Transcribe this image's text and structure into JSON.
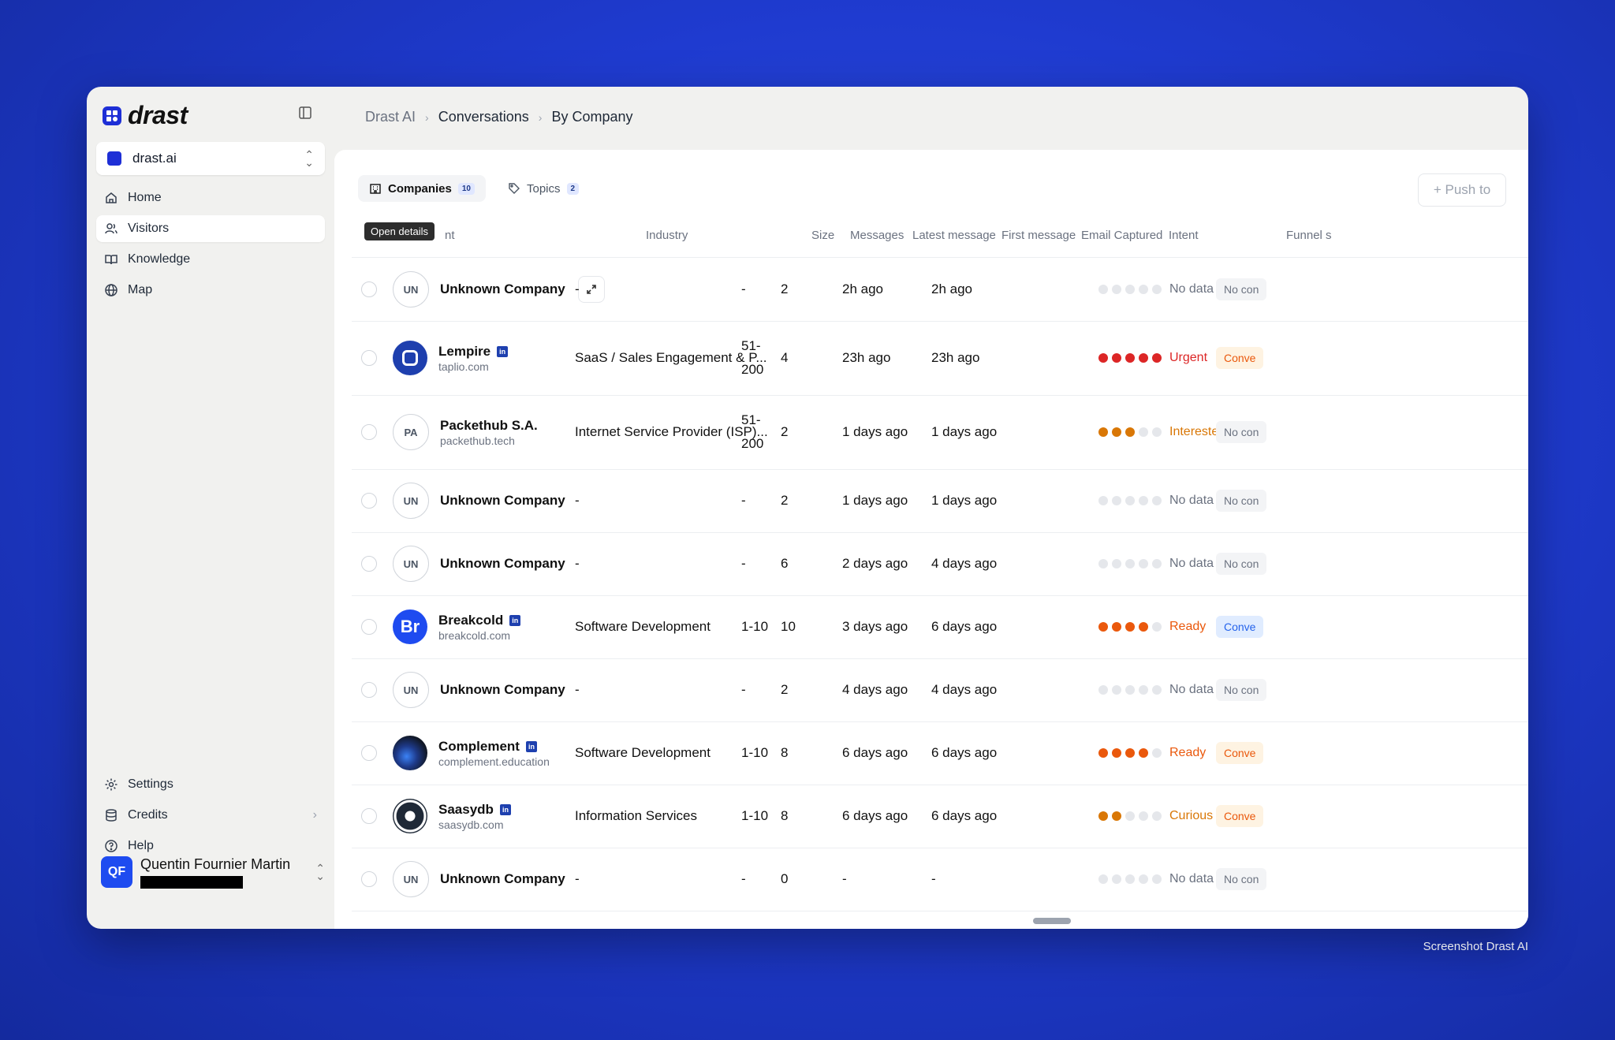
{
  "app": {
    "logo_text": "drast"
  },
  "workspace": {
    "name": "drast.ai"
  },
  "nav": {
    "home": "Home",
    "visitors": "Visitors",
    "knowledge": "Knowledge",
    "map": "Map",
    "settings": "Settings",
    "credits": "Credits",
    "help": "Help"
  },
  "user": {
    "initials": "QF",
    "name": "Quentin Fournier Martin"
  },
  "breadcrumb": {
    "root": "Drast AI",
    "section": "Conversations",
    "current": "By Company"
  },
  "tabs": {
    "companies": {
      "label": "Companies",
      "count": "10"
    },
    "topics": {
      "label": "Topics",
      "count": "2"
    }
  },
  "push_button": "+ Push to",
  "tooltip": "Open details",
  "columns": {
    "account": "nt",
    "industry": "Industry",
    "size": "Size",
    "messages": "Messages",
    "latest": "Latest message",
    "first": "First message",
    "email": "Email Captured",
    "intent": "Intent",
    "funnel": "Funnel s"
  },
  "colors": {
    "urgent": "#dc2626",
    "interested": "#d97706",
    "ready": "#ea580c",
    "curious": "#d97706",
    "dot_empty": "#e5e7eb",
    "accent": "#1e2fd6"
  },
  "rows": [
    {
      "avatar": "UN",
      "name": "Unknown Company",
      "domain": "",
      "linkedin": false,
      "industry": "-",
      "size": "-",
      "size2": "",
      "messages": "2",
      "latest": "2h ago",
      "first": "2h ago",
      "intent": "No data",
      "intent_level": 0,
      "funnel": "No con"
    },
    {
      "avatar": "",
      "name": "Lempire",
      "domain": "taplio.com",
      "linkedin": true,
      "linkedin_label": "in",
      "industry": "SaaS / Sales Engagement & P...",
      "size": "51-",
      "size2": "200",
      "messages": "4",
      "latest": "23h ago",
      "first": "23h ago",
      "intent": "Urgent",
      "intent_level": 5,
      "funnel": "Conve"
    },
    {
      "avatar": "PA",
      "name": "Packethub S.A.",
      "domain": "packethub.tech",
      "linkedin": false,
      "industry": "Internet Service Provider (ISP)...",
      "size": "51-",
      "size2": "200",
      "messages": "2",
      "latest": "1 days ago",
      "first": "1 days ago",
      "intent": "Interested",
      "intent_level": 3,
      "funnel": "No con"
    },
    {
      "avatar": "UN",
      "name": "Unknown Company",
      "domain": "",
      "linkedin": false,
      "industry": "-",
      "size": "-",
      "size2": "",
      "messages": "2",
      "latest": "1 days ago",
      "first": "1 days ago",
      "intent": "No data",
      "intent_level": 0,
      "funnel": "No con"
    },
    {
      "avatar": "UN",
      "name": "Unknown Company",
      "domain": "",
      "linkedin": false,
      "industry": "-",
      "size": "-",
      "size2": "",
      "messages": "6",
      "latest": "2 days ago",
      "first": "4 days ago",
      "intent": "No data",
      "intent_level": 0,
      "funnel": "No con"
    },
    {
      "avatar": "Br",
      "name": "Breakcold",
      "domain": "breakcold.com",
      "linkedin": true,
      "linkedin_label": "in",
      "industry": "Software Development",
      "size": "1-10",
      "size2": "",
      "messages": "10",
      "latest": "3 days ago",
      "first": "6 days ago",
      "intent": "Ready",
      "intent_level": 4,
      "funnel": "Conve"
    },
    {
      "avatar": "UN",
      "name": "Unknown Company",
      "domain": "",
      "linkedin": false,
      "industry": "-",
      "size": "-",
      "size2": "",
      "messages": "2",
      "latest": "4 days ago",
      "first": "4 days ago",
      "intent": "No data",
      "intent_level": 0,
      "funnel": "No con"
    },
    {
      "avatar": "",
      "name": "Complement",
      "domain": "complement.education",
      "linkedin": true,
      "linkedin_label": "in",
      "industry": "Software Development",
      "size": "1-10",
      "size2": "",
      "messages": "8",
      "latest": "6 days ago",
      "first": "6 days ago",
      "intent": "Ready",
      "intent_level": 4,
      "funnel": "Conve"
    },
    {
      "avatar": "",
      "name": "Saasydb",
      "domain": "saasydb.com",
      "linkedin": true,
      "linkedin_label": "in",
      "industry": "Information Services",
      "size": "1-10",
      "size2": "",
      "messages": "8",
      "latest": "6 days ago",
      "first": "6 days ago",
      "intent": "Curious",
      "intent_level": 2,
      "funnel": "Conve"
    },
    {
      "avatar": "UN",
      "name": "Unknown Company",
      "domain": "",
      "linkedin": false,
      "industry": "-",
      "size": "-",
      "size2": "",
      "messages": "0",
      "latest": "-",
      "first": "-",
      "intent": "No data",
      "intent_level": 0,
      "funnel": "No con"
    }
  ],
  "caption": "Screenshot Drast AI"
}
